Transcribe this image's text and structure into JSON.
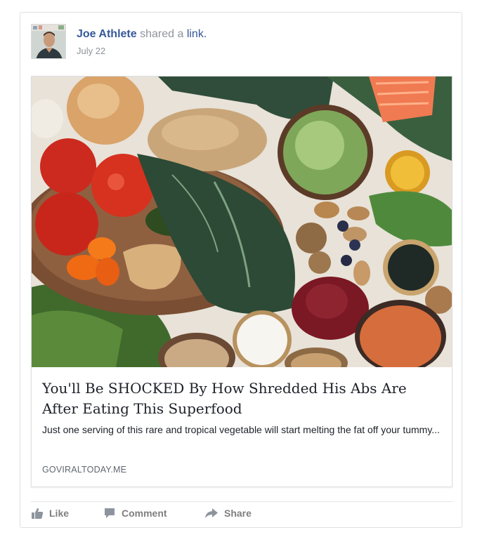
{
  "post": {
    "author": "Joe Athlete",
    "action_text": " shared a ",
    "link_word": "link.",
    "date": "July 22"
  },
  "card": {
    "title": "You'll Be SHOCKED By How Shredded His Abs Are After Eating This Superfood",
    "description": "Just one serving of this rare and tropical vegetable will start melting the fat off your tummy...",
    "domain": "GOVIRALTODAY.ME"
  },
  "actions": {
    "like": "Like",
    "comment": "Comment",
    "share": "Share"
  },
  "icons": [
    "like-icon",
    "comment-icon",
    "share-icon"
  ],
  "colors": {
    "author_link": "#365899",
    "meta_gray": "#90949c",
    "action_gray": "#7f7f7f",
    "border": "#dddfe2"
  }
}
